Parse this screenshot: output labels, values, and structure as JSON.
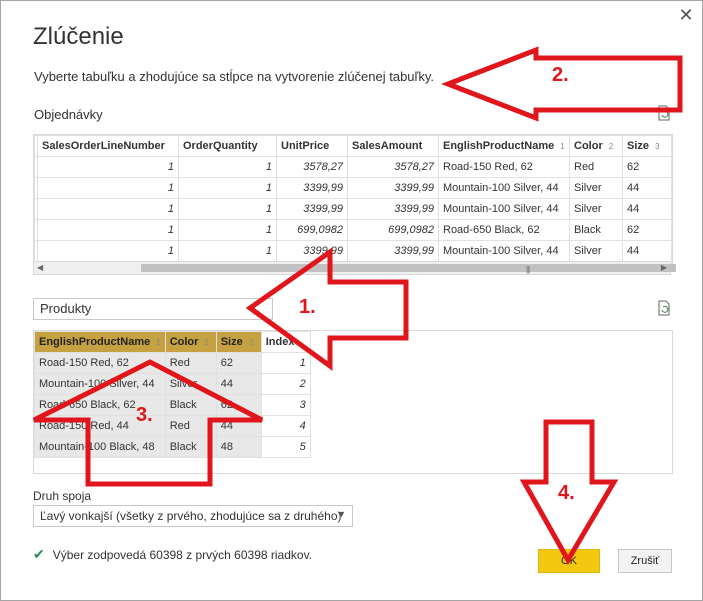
{
  "dialog": {
    "title": "Zlúčenie",
    "subtitle": "Vyberte tabuľku a zhodujúce sa stĺpce na vytvorenie zlúčenej tabuľky.",
    "close_glyph": "✕"
  },
  "table1": {
    "label": "Objednávky",
    "columns": [
      "SalesOrderLineNumber",
      "OrderQuantity",
      "UnitPrice",
      "SalesAmount",
      "EnglishProductName",
      "Color",
      "Size"
    ],
    "badges": [
      "",
      "",
      "",
      "",
      "1",
      "2",
      "3"
    ],
    "rows": [
      [
        "1",
        "1",
        "3578,27",
        "3578,27",
        "Road-150 Red, 62",
        "Red",
        "62"
      ],
      [
        "1",
        "1",
        "3399,99",
        "3399,99",
        "Mountain-100 Silver, 44",
        "Silver",
        "44"
      ],
      [
        "1",
        "1",
        "3399,99",
        "3399,99",
        "Mountain-100 Silver, 44",
        "Silver",
        "44"
      ],
      [
        "1",
        "1",
        "699,0982",
        "699,0982",
        "Road-650 Black, 62",
        "Black",
        "62"
      ],
      [
        "1",
        "1",
        "3399,99",
        "3399,99",
        "Mountain-100 Silver, 44",
        "Silver",
        "44"
      ]
    ]
  },
  "table2": {
    "selected_table": "Produkty",
    "columns": [
      "EnglishProductName",
      "Color",
      "Size",
      "Index"
    ],
    "badges": [
      "1",
      "2",
      "3",
      ""
    ],
    "rows": [
      [
        "Road-150 Red, 62",
        "Red",
        "62",
        "1"
      ],
      [
        "Mountain-100 Silver, 44",
        "Silver",
        "44",
        "2"
      ],
      [
        "Road-650 Black, 62",
        "Black",
        "62",
        "3"
      ],
      [
        "Road-150 Red, 44",
        "Red",
        "44",
        "4"
      ],
      [
        "Mountain-100 Black, 48",
        "Black",
        "48",
        "5"
      ]
    ]
  },
  "join": {
    "label": "Druh spoja",
    "value": "Ľavý vonkajší (všetky z prvého, zhodujúce sa z druhého)"
  },
  "status": {
    "text": "Výber zodpovedá 60398 z prvých 60398 riadkov."
  },
  "buttons": {
    "ok": "OK",
    "cancel": "Zrušiť"
  },
  "annotations": [
    "1.",
    "2.",
    "3.",
    "4."
  ],
  "colors": {
    "accent": "#f2c811",
    "selected_column": "#c5a142",
    "annotation": "#e0161c",
    "check": "#2e8b57"
  }
}
